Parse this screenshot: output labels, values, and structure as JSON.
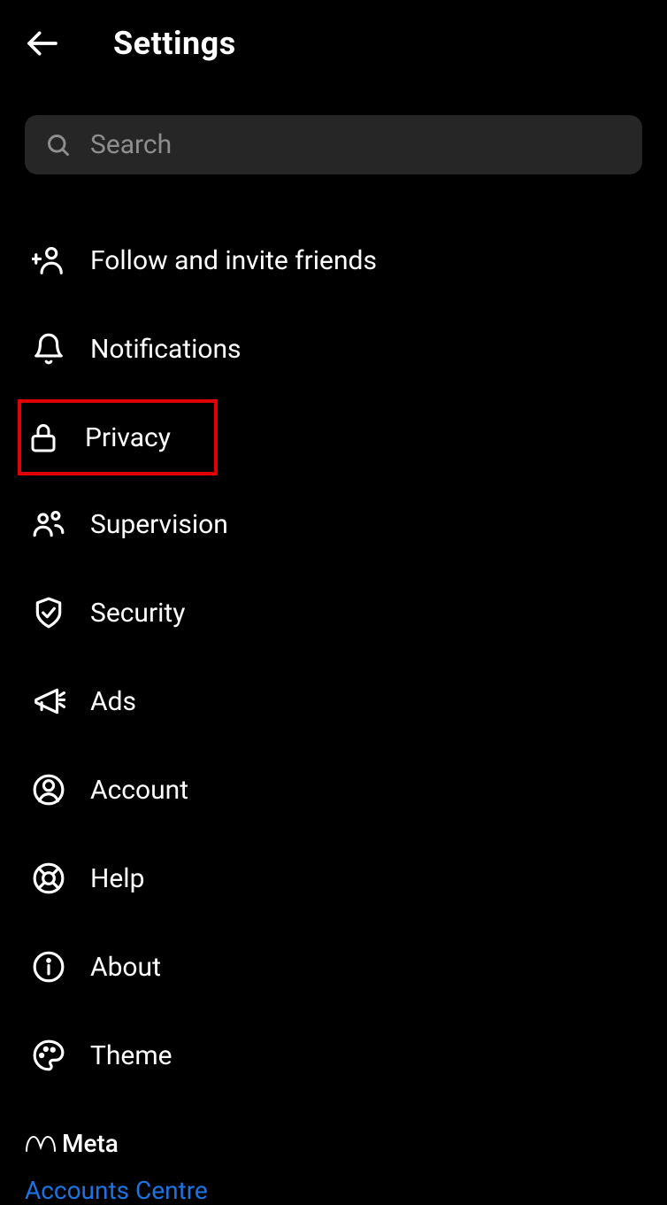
{
  "header": {
    "title": "Settings"
  },
  "search": {
    "placeholder": "Search"
  },
  "menu": {
    "items": [
      {
        "label": "Follow and invite friends"
      },
      {
        "label": "Notifications"
      },
      {
        "label": "Privacy"
      },
      {
        "label": "Supervision"
      },
      {
        "label": "Security"
      },
      {
        "label": "Ads"
      },
      {
        "label": "Account"
      },
      {
        "label": "Help"
      },
      {
        "label": "About"
      },
      {
        "label": "Theme"
      }
    ]
  },
  "footer": {
    "brand": "Meta",
    "accounts_link": "Accounts Centre"
  }
}
